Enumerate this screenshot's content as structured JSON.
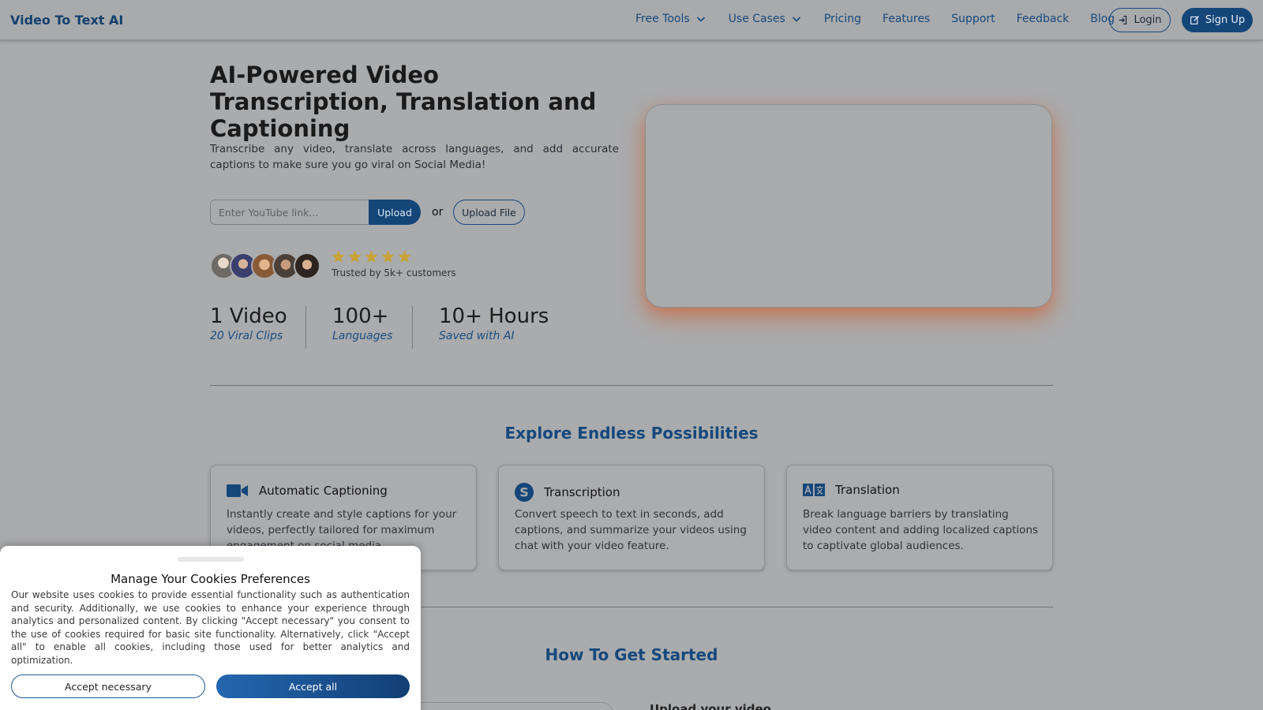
{
  "header": {
    "brand": "Video To Text AI",
    "nav": [
      {
        "label": "Free Tools",
        "has_dropdown": true
      },
      {
        "label": "Use Cases",
        "has_dropdown": true
      },
      {
        "label": "Pricing"
      },
      {
        "label": "Features"
      },
      {
        "label": "Support"
      },
      {
        "label": "Feedback"
      },
      {
        "label": "Blog"
      }
    ],
    "login_label": "Login",
    "signup_label": "Sign Up"
  },
  "hero": {
    "title": "AI-Powered Video Transcription, Translation and Captioning",
    "description": "Transcribe any video, translate across languages, and add accurate captions to make sure you go viral on Social Media!",
    "input_placeholder": "Enter YouTube link...",
    "upload_label": "Upload",
    "or_label": "or",
    "upload_file_label": "Upload File",
    "rating_stars": 5,
    "trusted_text": "Trusted by 5k+ customers",
    "stats": [
      {
        "value": "1 Video",
        "label": "20 Viral Clips"
      },
      {
        "value": "100+",
        "label": "Languages"
      },
      {
        "value": "10+ Hours",
        "label": "Saved with AI"
      }
    ]
  },
  "features": {
    "title": "Explore Endless Possibilities",
    "cards": [
      {
        "icon": "video-camera-icon",
        "title": "Automatic Captioning",
        "text": "Instantly create and style captions for your videos, perfectly tailored for maximum engagement on social media."
      },
      {
        "icon": "transcription-s-icon",
        "title": "Transcription",
        "text": "Convert speech to text in seconds, add captions, and summarize your videos using chat with your video feature."
      },
      {
        "icon": "translate-icon",
        "title": "Translation",
        "text": "Break language barriers by translating video content and adding localized captions to captivate global audiences."
      }
    ]
  },
  "get_started": {
    "title": "How To Get Started",
    "step_title": "Upload your video"
  },
  "cookie": {
    "title": "Manage Your Cookies Preferences",
    "body": "Our website uses cookies to provide essential functionality such as authentication and security. Additionally, we use cookies to enhance your experience through analytics and personalized content. By clicking \"Accept necessary\" you consent to the use of cookies required for basic site functionality. Alternatively, click \"Accept all\" to enable all cookies, including those used for better analytics and optimization.",
    "accept_necessary_label": "Accept necessary",
    "accept_all_label": "Accept all"
  },
  "colors": {
    "primary": "#15467a",
    "accent_glow": "#ce6230",
    "star": "#c9a338"
  }
}
